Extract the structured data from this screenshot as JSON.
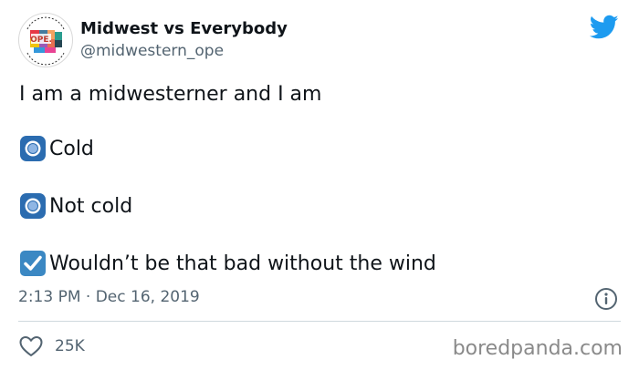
{
  "header": {
    "display_name": "Midwest vs Everybody",
    "handle": "@midwestern_ope",
    "avatar_text": "OPE."
  },
  "tweet": {
    "text": "I am a midwesterner and I am",
    "options": [
      {
        "label": "Cold",
        "marker": "radio-icon"
      },
      {
        "label": "Not cold",
        "marker": "radio-icon"
      },
      {
        "label": "Wouldn’t be that bad without the wind",
        "marker": "checkbox-checked-icon"
      }
    ]
  },
  "meta": {
    "timestamp": "2:13 PM · Dec 16, 2019"
  },
  "footer": {
    "likes": "25K",
    "watermark": "boredpanda.com"
  },
  "colors": {
    "twitter_blue": "#1d9bf0",
    "text": "#0f1419",
    "secondary": "#536471",
    "radio_blue": "#2b6cb0"
  }
}
